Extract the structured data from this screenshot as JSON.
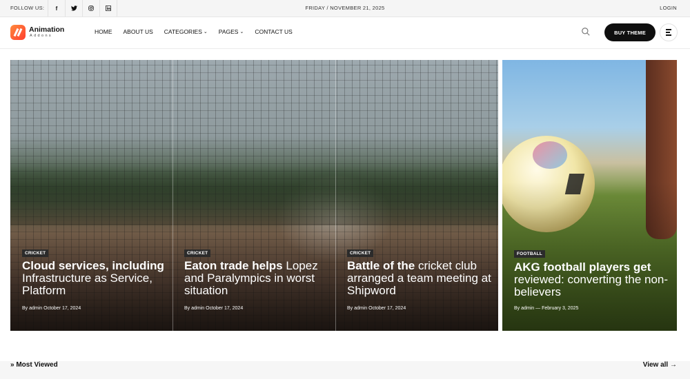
{
  "topbar": {
    "follow_label": "FOLLOW US:",
    "socials": [
      {
        "icon": "facebook-icon",
        "glyph": "f"
      },
      {
        "icon": "twitter-icon",
        "glyph": "t"
      },
      {
        "icon": "instagram-icon",
        "glyph": "◎"
      },
      {
        "icon": "linkedin-icon",
        "glyph": "in"
      }
    ],
    "date": "FRIDAY / NOVEMBER 21, 2025",
    "login": "LOGIN"
  },
  "header": {
    "logo_title": "Animation",
    "logo_sub": "Addons",
    "nav": [
      {
        "label": "HOME",
        "dropdown": false
      },
      {
        "label": "ABOUT US",
        "dropdown": false
      },
      {
        "label": "CATEGORIES",
        "dropdown": true
      },
      {
        "label": "PAGES",
        "dropdown": true
      },
      {
        "label": "CONTACT US",
        "dropdown": false
      }
    ],
    "buy_theme": "BUY THEME"
  },
  "hero": {
    "cards": [
      {
        "category": "CRICKET",
        "title_bold": "Cloud services, including",
        "title_rest": "Infrastructure as Service, Platform",
        "meta": "By admin  October 17, 2024"
      },
      {
        "category": "CRICKET",
        "title_bold": "Eaton trade helps",
        "title_rest": "Lopez and Paralympics in worst situation",
        "meta": "By admin  October 17, 2024"
      },
      {
        "category": "CRICKET",
        "title_bold": "Battle of the",
        "title_rest": "cricket club arranged a team meeting at Shipword",
        "meta": "By admin  October 17, 2024"
      }
    ],
    "side": {
      "category": "FOOTBALL",
      "title_bold": "AKG football players get",
      "title_rest": "reviewed: converting the non-believers",
      "meta": "By admin  — February 3, 2025"
    }
  },
  "most_viewed": {
    "title": "Most Viewed",
    "view_all": "View all"
  }
}
